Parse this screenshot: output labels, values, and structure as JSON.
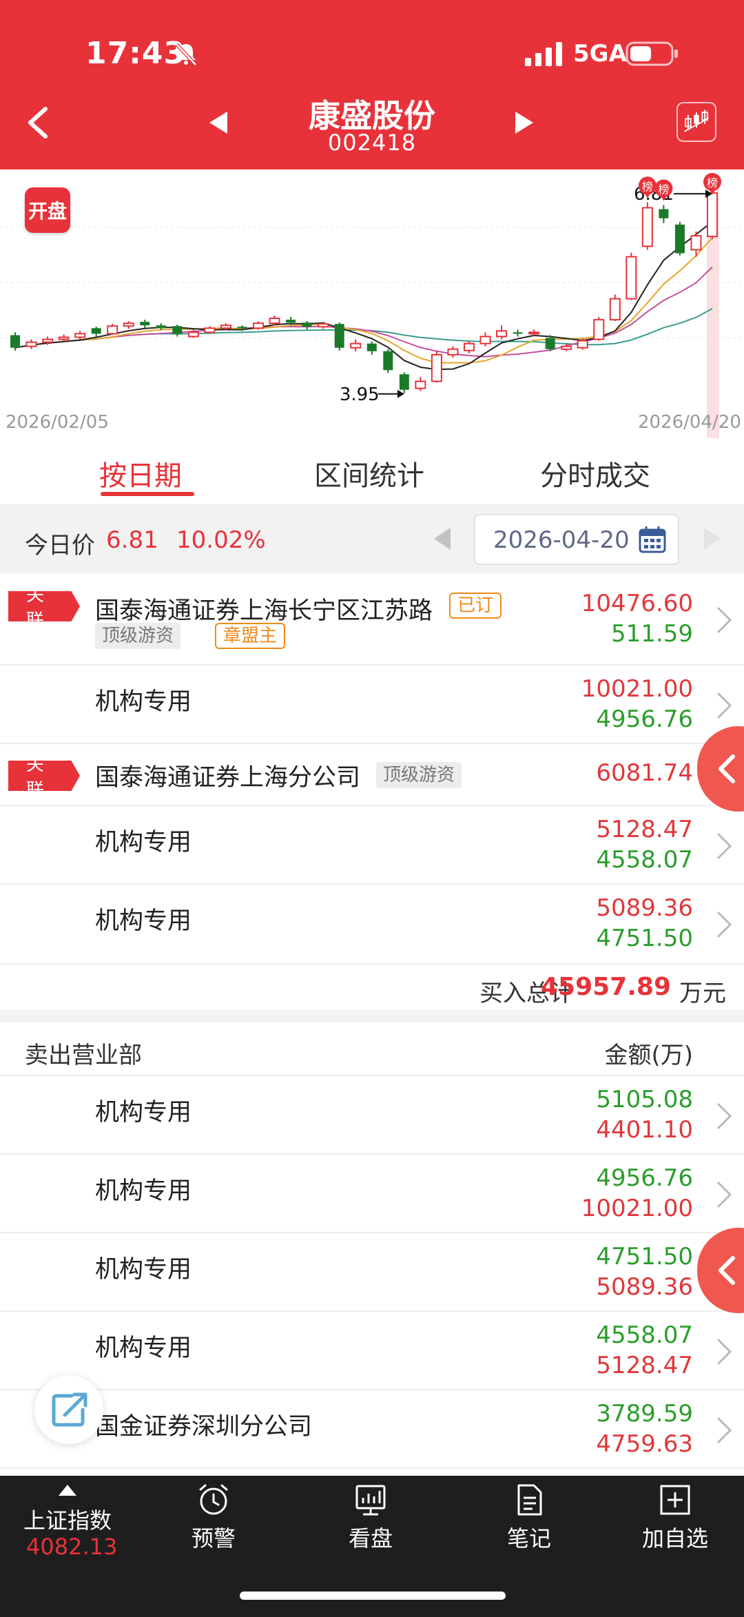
{
  "status_bar": {
    "time": "17:43",
    "network": "5GA"
  },
  "header": {
    "title": "康盛股份",
    "code": "002418"
  },
  "chart": {
    "badge": "开盘",
    "date_start": "2026/02/05",
    "date_end": "2026/04/20",
    "high_label": "6.81",
    "low_label": "3.95",
    "list_marker": "榜"
  },
  "chart_data": {
    "type": "candlestick",
    "x_start": "2026/02/05",
    "x_end": "2026/04/20",
    "annotations": [
      {
        "label": "6.81",
        "kind": "high"
      },
      {
        "label": "3.95",
        "kind": "low"
      }
    ],
    "colors": {
      "up": "#e8323a",
      "down": "#1b7a2a",
      "ma1": "#222222",
      "ma2": "#e5a52b",
      "ma3": "#c44fa0",
      "ma4": "#3a9d8c"
    },
    "candles": [
      {
        "o": 4.78,
        "c": 4.6,
        "h": 4.82,
        "l": 4.56
      },
      {
        "o": 4.62,
        "c": 4.68,
        "h": 4.72,
        "l": 4.58
      },
      {
        "o": 4.68,
        "c": 4.72,
        "h": 4.76,
        "l": 4.64
      },
      {
        "o": 4.72,
        "c": 4.75,
        "h": 4.79,
        "l": 4.69
      },
      {
        "o": 4.75,
        "c": 4.8,
        "h": 4.84,
        "l": 4.72
      },
      {
        "o": 4.88,
        "c": 4.8,
        "h": 4.9,
        "l": 4.76
      },
      {
        "o": 4.8,
        "c": 4.91,
        "h": 4.94,
        "l": 4.78
      },
      {
        "o": 4.91,
        "c": 4.95,
        "h": 4.98,
        "l": 4.87
      },
      {
        "o": 4.97,
        "c": 4.92,
        "h": 5.0,
        "l": 4.88
      },
      {
        "o": 4.92,
        "c": 4.88,
        "h": 4.95,
        "l": 4.85
      },
      {
        "o": 4.91,
        "c": 4.79,
        "h": 4.93,
        "l": 4.76
      },
      {
        "o": 4.76,
        "c": 4.82,
        "h": 4.86,
        "l": 4.74
      },
      {
        "o": 4.82,
        "c": 4.88,
        "h": 4.91,
        "l": 4.8
      },
      {
        "o": 4.88,
        "c": 4.92,
        "h": 4.95,
        "l": 4.85
      },
      {
        "o": 4.9,
        "c": 4.88,
        "h": 4.92,
        "l": 4.84
      },
      {
        "o": 4.88,
        "c": 4.95,
        "h": 4.98,
        "l": 4.86
      },
      {
        "o": 4.95,
        "c": 5.02,
        "h": 5.06,
        "l": 4.92
      },
      {
        "o": 5.0,
        "c": 4.96,
        "h": 5.04,
        "l": 4.92
      },
      {
        "o": 4.96,
        "c": 4.9,
        "h": 4.98,
        "l": 4.86
      },
      {
        "o": 4.9,
        "c": 4.94,
        "h": 4.97,
        "l": 4.87
      },
      {
        "o": 4.94,
        "c": 4.6,
        "h": 4.96,
        "l": 4.56
      },
      {
        "o": 4.6,
        "c": 4.66,
        "h": 4.72,
        "l": 4.55
      },
      {
        "o": 4.66,
        "c": 4.55,
        "h": 4.69,
        "l": 4.5
      },
      {
        "o": 4.55,
        "c": 4.28,
        "h": 4.58,
        "l": 4.24
      },
      {
        "o": 4.22,
        "c": 4.0,
        "h": 4.25,
        "l": 3.95
      },
      {
        "o": 4.02,
        "c": 4.12,
        "h": 4.18,
        "l": 3.98
      },
      {
        "o": 4.12,
        "c": 4.5,
        "h": 4.56,
        "l": 4.1
      },
      {
        "o": 4.5,
        "c": 4.58,
        "h": 4.62,
        "l": 4.46
      },
      {
        "o": 4.56,
        "c": 4.66,
        "h": 4.7,
        "l": 4.52
      },
      {
        "o": 4.66,
        "c": 4.76,
        "h": 4.82,
        "l": 4.62
      },
      {
        "o": 4.76,
        "c": 4.84,
        "h": 4.92,
        "l": 4.72
      },
      {
        "o": 4.82,
        "c": 4.8,
        "h": 4.86,
        "l": 4.76
      },
      {
        "o": 4.8,
        "c": 4.82,
        "h": 4.86,
        "l": 4.77
      },
      {
        "o": 4.74,
        "c": 4.58,
        "h": 4.78,
        "l": 4.55
      },
      {
        "o": 4.58,
        "c": 4.62,
        "h": 4.66,
        "l": 4.55
      },
      {
        "o": 4.6,
        "c": 4.7,
        "h": 4.74,
        "l": 4.57
      },
      {
        "o": 4.72,
        "c": 5.0,
        "h": 5.04,
        "l": 4.7
      },
      {
        "o": 5.0,
        "c": 5.3,
        "h": 5.36,
        "l": 4.98
      },
      {
        "o": 5.3,
        "c": 5.9,
        "h": 5.96,
        "l": 5.28
      },
      {
        "o": 6.05,
        "c": 6.6,
        "h": 6.68,
        "l": 6.0
      },
      {
        "o": 6.58,
        "c": 6.45,
        "h": 6.64,
        "l": 6.38
      },
      {
        "o": 6.36,
        "c": 5.95,
        "h": 6.4,
        "l": 5.92
      },
      {
        "o": 6.0,
        "c": 6.2,
        "h": 6.26,
        "l": 5.9
      },
      {
        "o": 6.19,
        "c": 6.81,
        "h": 6.81,
        "l": 6.15
      }
    ]
  },
  "tabs": [
    {
      "label": "按日期",
      "active": true
    },
    {
      "label": "区间统计",
      "active": false
    },
    {
      "label": "分时成交",
      "active": false
    }
  ],
  "price_row": {
    "label": "今日价",
    "price": "6.81",
    "pct": "10.02%",
    "date": "2026-04-20"
  },
  "buy_rows": [
    {
      "name": "国泰海通证券上海长宁区江苏路",
      "related": "关 联",
      "tags": [
        "已订"
      ],
      "subtags_gray": [
        "顶级游资"
      ],
      "subtags_orange": [
        "章盟主"
      ],
      "buy": "10476.60",
      "sell": "511.59"
    },
    {
      "name": "机构专用",
      "buy": "10021.00",
      "sell": "4956.76"
    },
    {
      "name": "国泰海通证券上海分公司",
      "related": "关 联",
      "tags_gray": [
        "顶级游资"
      ],
      "buy": "6081.74"
    },
    {
      "name": "机构专用",
      "buy": "5128.47",
      "sell": "4558.07"
    },
    {
      "name": "机构专用",
      "buy": "5089.36",
      "sell": "4751.50"
    }
  ],
  "total": {
    "label": "买入总计",
    "value": "45957.89",
    "unit": "万元"
  },
  "sell_header": {
    "title": "卖出营业部",
    "amount": "金额(万)"
  },
  "sell_rows": [
    {
      "name": "机构专用",
      "sell": "5105.08",
      "buy": "4401.10"
    },
    {
      "name": "机构专用",
      "sell": "4956.76",
      "buy": "10021.00"
    },
    {
      "name": "机构专用",
      "sell": "4751.50",
      "buy": "5089.36"
    },
    {
      "name": "机构专用",
      "sell": "4558.07",
      "buy": "5128.47"
    },
    {
      "name": "国金证券深圳分公司",
      "sell": "3789.59",
      "buy": "4759.63"
    }
  ],
  "bottom_nav": {
    "index_name": "上证指数",
    "index_value": "4082.13",
    "items": [
      {
        "label": "预警",
        "icon": "alarm-clock-icon"
      },
      {
        "label": "看盘",
        "icon": "monitor-chart-icon"
      },
      {
        "label": "笔记",
        "icon": "note-icon"
      },
      {
        "label": "加自选",
        "icon": "plus-square-icon"
      }
    ]
  }
}
